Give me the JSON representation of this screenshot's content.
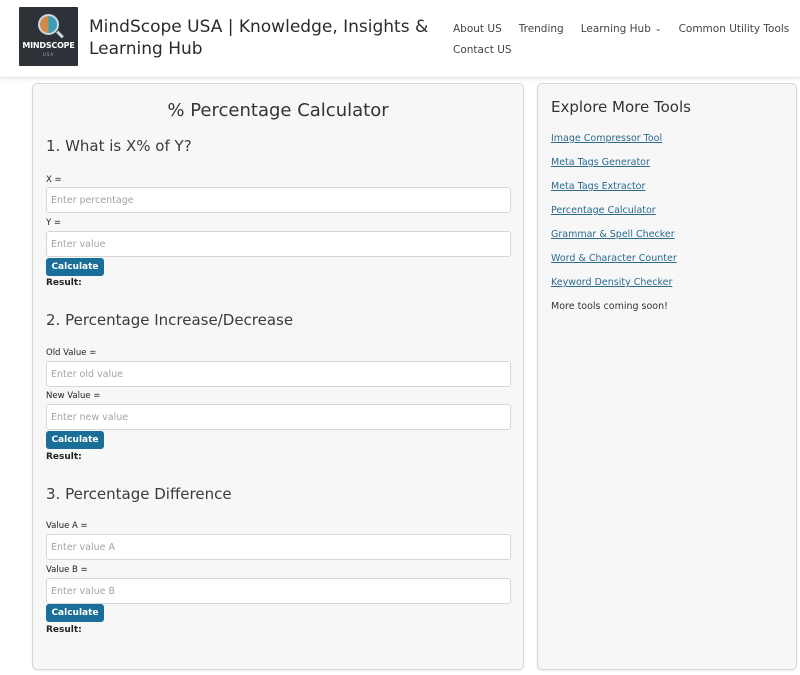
{
  "header": {
    "logo": {
      "brand": "MINDSCOPE",
      "sub": "USA"
    },
    "site_title": "MindScope USA | Knowledge, Insights & Learning Hub",
    "nav": [
      {
        "label": "About US"
      },
      {
        "label": "Trending"
      },
      {
        "label": "Learning Hub",
        "has_dropdown": true
      },
      {
        "label": "Common Utility Tools"
      },
      {
        "label": "Contact US"
      }
    ]
  },
  "main": {
    "title": "% Percentage Calculator",
    "sections": [
      {
        "title": "1. What is X% of Y?",
        "fields": [
          {
            "label": "X =",
            "placeholder": "Enter percentage",
            "value": ""
          },
          {
            "label": "Y =",
            "placeholder": "Enter value",
            "value": ""
          }
        ],
        "button": "Calculate",
        "result_label": "Result:"
      },
      {
        "title": "2. Percentage Increase/Decrease",
        "fields": [
          {
            "label": "Old Value =",
            "placeholder": "Enter old value",
            "value": ""
          },
          {
            "label": "New Value =",
            "placeholder": "Enter new value",
            "value": ""
          }
        ],
        "button": "Calculate",
        "result_label": "Result:"
      },
      {
        "title": "3. Percentage Difference",
        "fields": [
          {
            "label": "Value A =",
            "placeholder": "Enter value A",
            "value": ""
          },
          {
            "label": "Value B =",
            "placeholder": "Enter value B",
            "value": ""
          }
        ],
        "button": "Calculate",
        "result_label": "Result:"
      }
    ]
  },
  "sidebar": {
    "title": "Explore More Tools",
    "links": [
      {
        "label": "Image Compressor Tool"
      },
      {
        "label": "Meta Tags Generator"
      },
      {
        "label": "Meta Tags Extractor"
      },
      {
        "label": "Percentage Calculator"
      },
      {
        "label": "Grammar & Spell Checker"
      },
      {
        "label": "Word & Character Counter"
      },
      {
        "label": "Keyword Density Checker"
      }
    ],
    "note": "More tools coming soon!"
  },
  "colors": {
    "button": "#1a6f99",
    "link": "#2a6b8f",
    "card_bg": "#f7f7f7"
  }
}
